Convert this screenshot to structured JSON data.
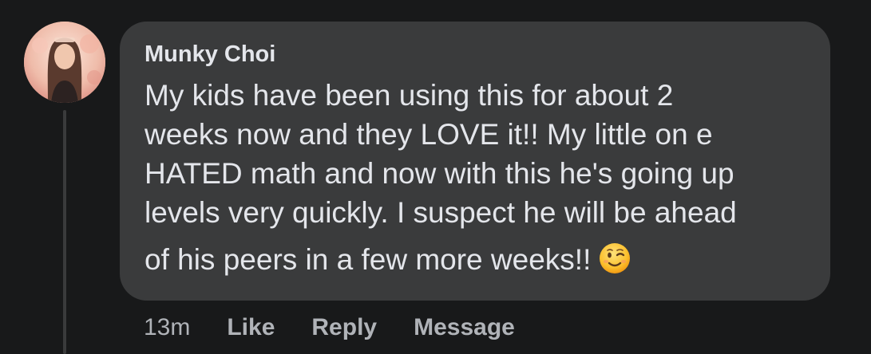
{
  "comment": {
    "author": "Munky Choi",
    "text_lines": [
      "My kids have been using this for about 2",
      "weeks now and they LOVE it!! My little on e",
      "HATED math and now with this he's going up",
      "levels very quickly. I suspect he will be ahead",
      "of his peers in a few more weeks!!"
    ],
    "emoji_icon": "winking-face-emoji",
    "timestamp": "13m",
    "actions": {
      "like": "Like",
      "reply": "Reply",
      "message": "Message"
    }
  },
  "colors": {
    "background": "#18191a",
    "bubble": "#3a3b3c",
    "primary_text": "#e4e6eb",
    "secondary_text": "#b0b3b8"
  }
}
